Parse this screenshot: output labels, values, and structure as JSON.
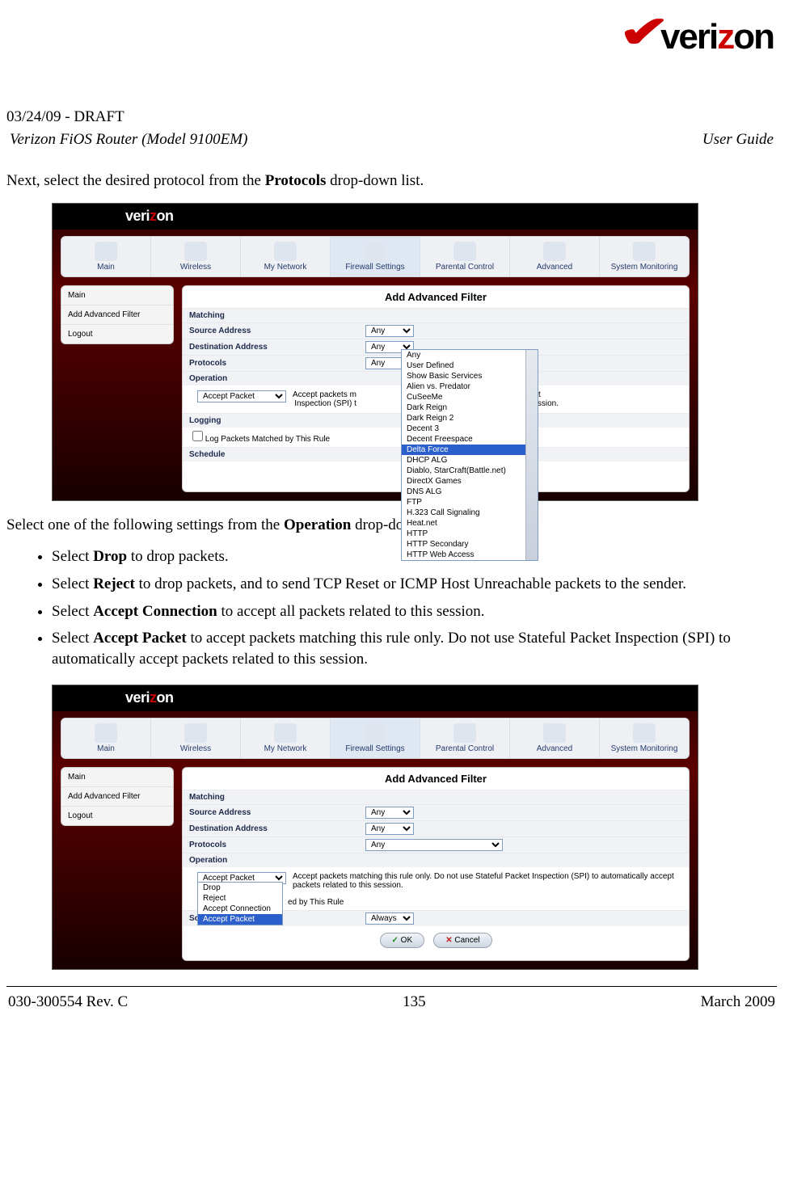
{
  "header": {
    "draft": "03/24/09 - DRAFT",
    "model": "Verizon FiOS Router (Model 9100EM)",
    "guide": "User Guide",
    "logo": "verizon"
  },
  "para1_pre": "Next, select the desired protocol from the ",
  "para1_bold": "Protocols",
  "para1_post": " drop-down list.",
  "para2_pre": "Select one of the following settings from the ",
  "para2_bold": "Operation",
  "para2_post": " drop-down list:",
  "bullets": [
    {
      "pre": "Select ",
      "bold": "Drop",
      "post": " to drop packets."
    },
    {
      "pre": "Select ",
      "bold": "Reject",
      "post": " to drop packets, and to send TCP Reset or ICMP Host Unreachable packets to the sender."
    },
    {
      "pre": "Select ",
      "bold": "Accept Connection",
      "post": " to accept all packets related to this session."
    },
    {
      "pre": "Select ",
      "bold": "Accept Packet",
      "post": " to accept packets matching this rule only. Do not use Stateful Packet Inspection (SPI) to automatically accept packets related to this session."
    }
  ],
  "footer": {
    "left": "030-300554 Rev. C",
    "center": "135",
    "right": "March 2009"
  },
  "ui": {
    "brand": "verizon",
    "nav": [
      "Main",
      "Wireless",
      "My Network",
      "Firewall Settings",
      "Parental Control",
      "Advanced",
      "System Monitoring"
    ],
    "nav_active": 3,
    "side": [
      "Main",
      "Add Advanced Filter",
      "Logout"
    ],
    "panel_title": "Add Advanced Filter",
    "rows": {
      "matching": "Matching",
      "source": "Source Address",
      "dest": "Destination Address",
      "protocols": "Protocols",
      "operation": "Operation",
      "logging": "Logging",
      "schedule": "Schedule"
    },
    "any": "Any",
    "always": "Always",
    "op_value": "Accept Packet",
    "op_desc_1": "Accept packets matching this rule only. Do not use Stateful Packet Inspection (SPI) to automatically accept packets related to this session.",
    "op_desc_truncL": "Accept packets m",
    "op_desc_truncR1": "ateful Packet",
    "op_desc_truncR2": "ed to this session.",
    "spi_line2": "Inspection (SPI) t",
    "log_checkbox": "Log Packets Matched by This Rule",
    "log_trunc": "ed by This Rule",
    "ok": "OK",
    "cancel": "Cancel",
    "protocols_options": [
      "Any",
      "User Defined",
      "Show Basic Services",
      "Alien vs. Predator",
      "CuSeeMe",
      "Dark Reign",
      "Dark Reign 2",
      "Decent 3",
      "Decent Freespace",
      "Delta Force",
      "DHCP ALG",
      "Diablo, StarCraft(Battle.net)",
      "DirectX Games",
      "DNS ALG",
      "FTP",
      "H.323 Call Signaling",
      "Heat.net",
      "HTTP",
      "HTTP Secondary",
      "HTTP Web Access"
    ],
    "protocols_selected_index": 9,
    "operation_options": [
      "Drop",
      "Reject",
      "Accept Connection",
      "Accept Packet"
    ],
    "operation_selected_index": 3
  }
}
